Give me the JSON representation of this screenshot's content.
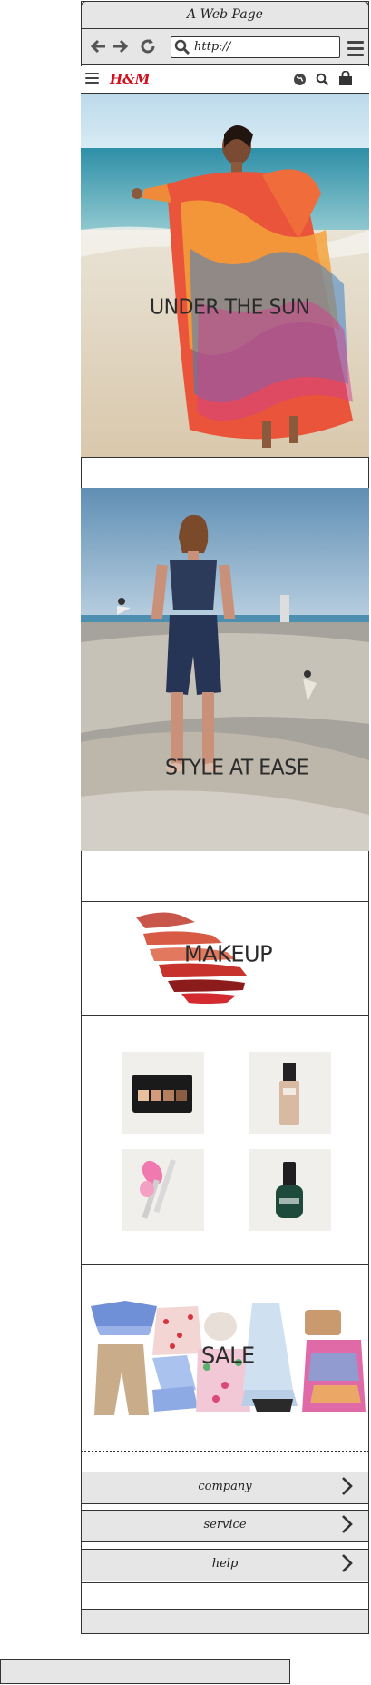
{
  "window": {
    "title": "A Web Page"
  },
  "toolbar": {
    "url": "http://",
    "back_icon": "arrow-left-icon",
    "forward_icon": "arrow-right-icon",
    "reload_icon": "reload-icon",
    "menu_icon": "menu-icon"
  },
  "site": {
    "logo": "H&M",
    "icons": [
      "hamburger-menu-icon",
      "globe-icon",
      "search-icon",
      "shopping-bag-icon"
    ],
    "brand_color": "#d0101c"
  },
  "sections": {
    "hero1": {
      "label": "UNDER THE SUN"
    },
    "hero2": {
      "label": "STYLE AT EASE"
    },
    "makeup": {
      "label": "MAKEUP"
    },
    "sale": {
      "label": "SALE"
    }
  },
  "products": [
    {
      "name": "contour-palette"
    },
    {
      "name": "foundation-bottle"
    },
    {
      "name": "makeup-brushes"
    },
    {
      "name": "nail-polish"
    }
  ],
  "footer": {
    "items": [
      {
        "label": "company"
      },
      {
        "label": "service"
      },
      {
        "label": "help"
      }
    ]
  }
}
